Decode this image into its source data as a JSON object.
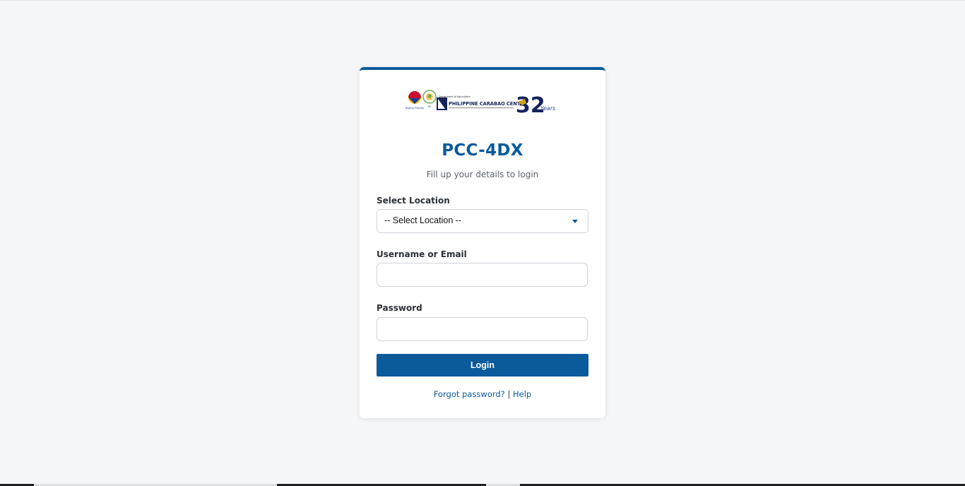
{
  "logos": {
    "seal1_caption": "Bagong Pilipinas",
    "seal2_caption": "DA",
    "pcc_small": "Department of Agriculture",
    "pcc_name": "PHILIPPINE CARABAO CENTER",
    "anniversary_number": "32",
    "anniversary_word": "Years"
  },
  "login": {
    "title": "PCC-4DX",
    "subtitle": "Fill up your details to login",
    "location_label": "Select Location",
    "location_selected": "-- Select Location --",
    "username_label": "Username or Email",
    "username_value": "",
    "password_label": "Password",
    "password_value": "",
    "login_button": "Login",
    "forgot_password": "Forgot password?",
    "separator": "|",
    "help": "Help"
  },
  "colors": {
    "accent": "#0a5a9c",
    "background": "#f6f7f9"
  }
}
